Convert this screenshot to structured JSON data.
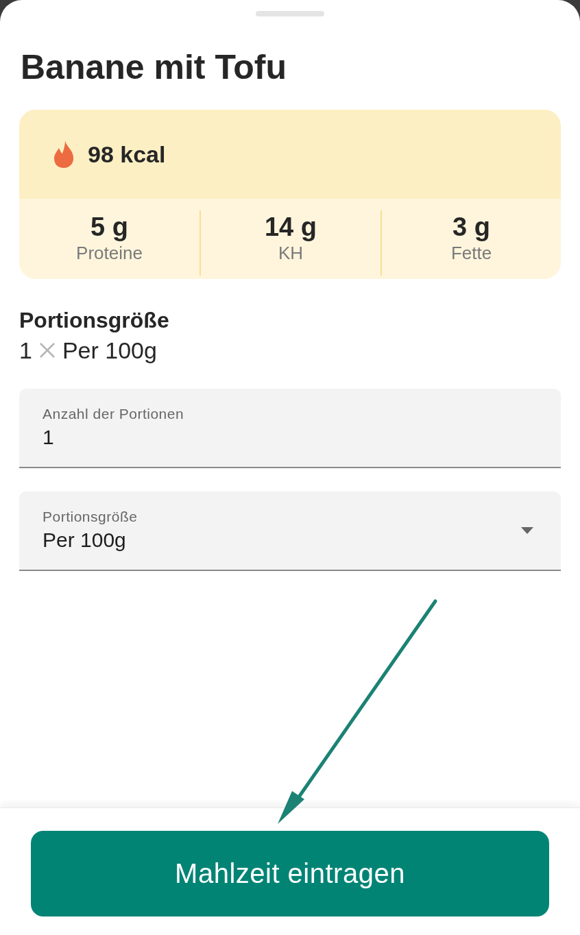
{
  "sheet": {
    "title": "Banane mit Tofu"
  },
  "nutrition": {
    "calories": "98 kcal",
    "macros": [
      {
        "value": "5 g",
        "label": "Proteine"
      },
      {
        "value": "14 g",
        "label": "KH"
      },
      {
        "value": "3 g",
        "label": "Fette"
      }
    ]
  },
  "portion": {
    "heading": "Portionsgröße",
    "count": "1",
    "unit": "Per 100g"
  },
  "fields": [
    {
      "kind": "text",
      "label": "Anzahl der Portionen",
      "value": "1"
    },
    {
      "kind": "dropdown",
      "label": "Portionsgröße",
      "value": "Per 100g"
    }
  ],
  "primary_button": {
    "label": "Mahlzeit eintragen"
  }
}
